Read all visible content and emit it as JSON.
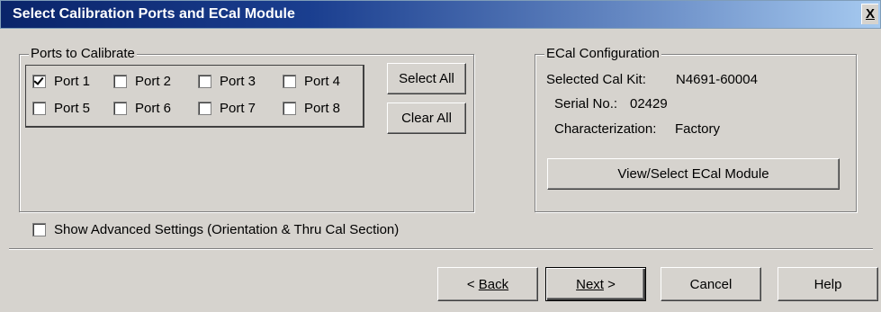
{
  "window": {
    "title": "Select Calibration Ports and ECal Module",
    "close_label": "X"
  },
  "ports_group": {
    "legend": "Ports to Calibrate",
    "ports": [
      {
        "label": "Port 1",
        "checked": true
      },
      {
        "label": "Port 2",
        "checked": false
      },
      {
        "label": "Port 3",
        "checked": false
      },
      {
        "label": "Port 4",
        "checked": false
      },
      {
        "label": "Port 5",
        "checked": false
      },
      {
        "label": "Port 6",
        "checked": false
      },
      {
        "label": "Port 7",
        "checked": false
      },
      {
        "label": "Port 8",
        "checked": false
      }
    ],
    "select_all_label": "Select All",
    "clear_all_label": "Clear All"
  },
  "ecal_group": {
    "legend": "ECal Configuration",
    "selected_cal_kit_label": "Selected Cal Kit:",
    "selected_cal_kit_value": "N4691-60004",
    "serial_label": "Serial No.:",
    "serial_value": "02429",
    "characterization_label": "Characterization:",
    "characterization_value": "Factory",
    "view_select_label": "View/Select ECal Module"
  },
  "advanced": {
    "label": "Show Advanced Settings (Orientation & Thru Cal Section)",
    "checked": false
  },
  "footer": {
    "back_label": "Back",
    "next_label": "Next",
    "cancel_label": "Cancel",
    "help_label": "Help"
  }
}
